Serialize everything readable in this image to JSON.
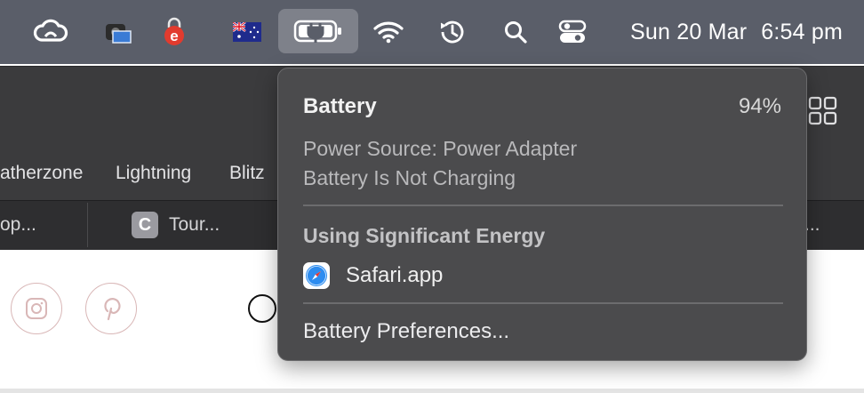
{
  "menubar": {
    "date": "Sun 20 Mar",
    "time": "6:54 pm"
  },
  "browser": {
    "bookmarks": [
      "atherzone",
      "Lightning",
      "Blitz"
    ],
    "tabs": [
      {
        "label": "op..."
      },
      {
        "label": "Tour...",
        "badge": "C"
      },
      {
        "label": "..."
      }
    ]
  },
  "battery_menu": {
    "title": "Battery",
    "percentage": "94%",
    "power_source": "Power Source: Power Adapter",
    "charging_status": "Battery Is Not Charging",
    "energy_heading": "Using Significant Energy",
    "energy_apps": [
      {
        "name": "Safari.app",
        "icon": "safari-icon"
      }
    ],
    "preferences_label": "Battery Preferences..."
  },
  "colors": {
    "menubar_bg": "#5a5e69",
    "panel_bg": "#4b4b4d",
    "social_ring": "#d9b7b7"
  }
}
